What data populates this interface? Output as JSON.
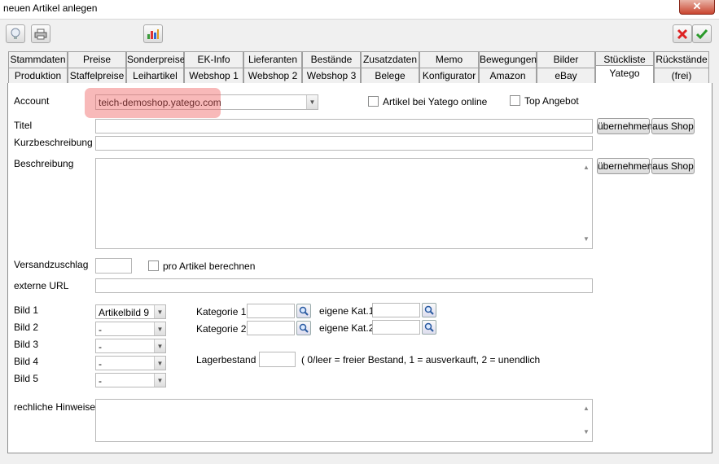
{
  "window": {
    "title": "neuen Artikel anlegen"
  },
  "toolbar": {
    "left_icons": [
      "lightbulb-icon",
      "printer-icon",
      "bar-chart-icon"
    ],
    "right_icons": [
      "cancel-x-icon",
      "confirm-check-icon"
    ]
  },
  "tabs_row1": [
    "Stammdaten",
    "Preise",
    "Sonderpreise",
    "EK-Info",
    "Lieferanten",
    "Bestände",
    "Zusatzdaten",
    "Memo",
    "Bewegungen",
    "Bilder",
    "Stückliste",
    "Rückstände"
  ],
  "tabs_row2": [
    "Produktion",
    "Staffelpreise",
    "Leihartikel",
    "Webshop 1",
    "Webshop 2",
    "Webshop 3",
    "Belege",
    "Konfigurator",
    "Amazon",
    "eBay",
    "Yatego",
    "(frei)"
  ],
  "active_tab": "Yatego",
  "form": {
    "account_label": "Account",
    "account_value": "teich-demoshop.yatego.com",
    "online_label": "Artikel bei Yatego online",
    "top_label": "Top Angebot",
    "titel_label": "Titel",
    "kurz_label": "Kurzbeschreibung",
    "beschreibung_label": "Beschreibung",
    "uebernehmen": "übernehmen",
    "aus_shop": "aus Shop",
    "versand_label": "Versandzuschlag",
    "pro_artikel_label": "pro Artikel berechnen",
    "url_label": "externe URL",
    "bild1_label": "Bild 1",
    "bild1_value": "Artikelbild 9",
    "bild2_label": "Bild 2",
    "bild2_value": "-",
    "bild3_label": "Bild 3",
    "bild3_value": "-",
    "bild4_label": "Bild 4",
    "bild4_value": "-",
    "bild5_label": "Bild 5",
    "bild5_value": "-",
    "kat1_label": "Kategorie 1",
    "kat2_label": "Kategorie 2",
    "eigene1_label": "eigene Kat.1",
    "eigene2_label": "eigene Kat.2",
    "lager_label": "Lagerbestand",
    "lager_hint": "( 0/leer = freier Bestand, 1 = ausverkauft, 2 = unendlich",
    "hinweise_label": "rechliche Hinweise"
  },
  "colors": {
    "highlight": "#f06464",
    "close": "#c9452f"
  }
}
